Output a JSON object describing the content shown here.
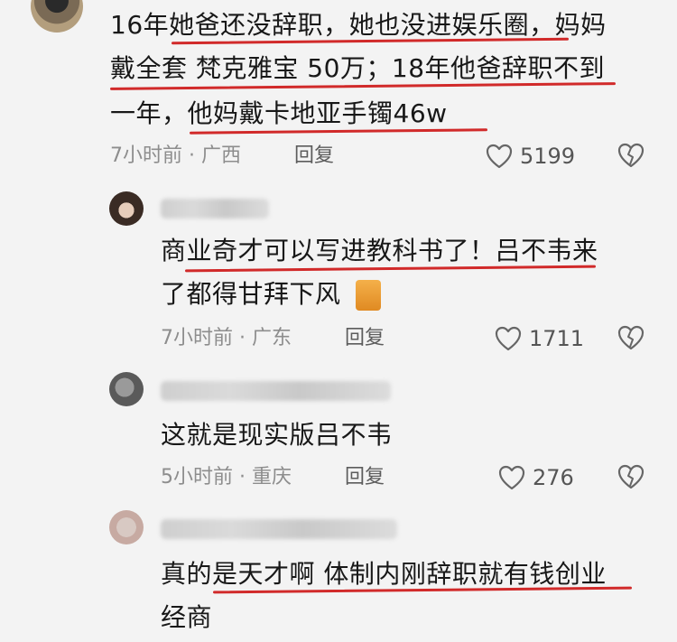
{
  "comments": [
    {
      "lines": [
        "16年她爸还没辞职，她也没进娱乐圈，妈妈",
        "戴全套 梵克雅宝  50万；18年他爸辞职不到",
        "一年，他妈戴卡地亚手镯46w"
      ],
      "time": "7小时前",
      "location": "广西",
      "reply": "回复",
      "likes": "5199"
    },
    {
      "lines": [
        "商业奇才可以写进教科书了！吕不韦来",
        "了都得甘拜下风"
      ],
      "time": "7小时前",
      "location": "广东",
      "reply": "回复",
      "likes": "1711"
    },
    {
      "lines": [
        "这就是现实版吕不韦"
      ],
      "time": "5小时前",
      "location": "重庆",
      "reply": "回复",
      "likes": "276"
    },
    {
      "lines": [
        "真的是天才啊 体制内刚辞职就有钱创业",
        "经商"
      ]
    }
  ],
  "meta_separator": "·",
  "colors": {
    "background": "#f3f3f3",
    "underline": "#d12a2a",
    "meta": "#8d8d8d"
  },
  "icons": [
    "heart-icon",
    "dislike-icon",
    "cat-emoji-icon"
  ]
}
